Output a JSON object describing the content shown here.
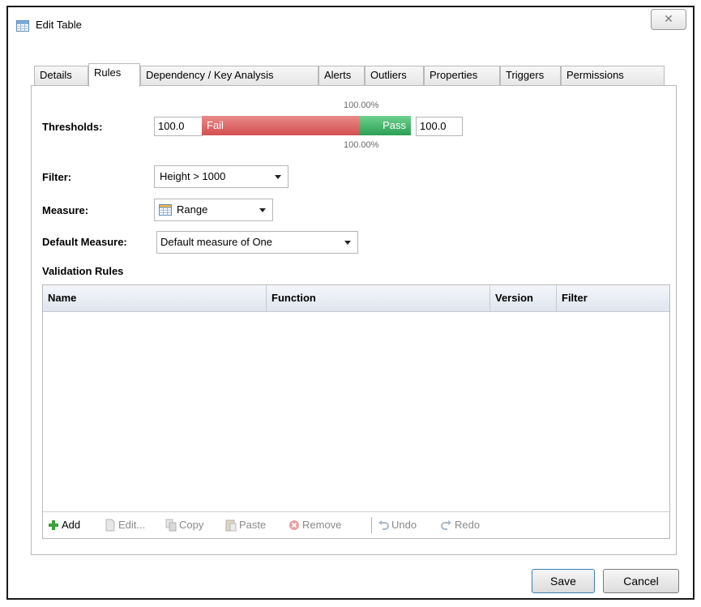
{
  "window": {
    "title": "Edit Table",
    "close_glyph": "✕"
  },
  "tabs": [
    {
      "label": "Details"
    },
    {
      "label": "Rules"
    },
    {
      "label": "Dependency / Key Analysis"
    },
    {
      "label": "Alerts"
    },
    {
      "label": "Outliers"
    },
    {
      "label": "Properties"
    },
    {
      "label": "Triggers"
    },
    {
      "label": "Permissions"
    }
  ],
  "active_tab": "Rules",
  "thresholds": {
    "label": "Thresholds:",
    "low_value": "100.0",
    "high_value": "100.0",
    "fail_label": "Fail",
    "pass_label": "Pass",
    "top_percent": "100.00%",
    "bottom_percent": "100.00%",
    "fail_fraction": 0.75,
    "fail_color": "#d9534f",
    "pass_color": "#3cb062"
  },
  "filter": {
    "label": "Filter:",
    "value": "Height > 1000"
  },
  "measure": {
    "label": "Measure:",
    "value": "Range",
    "icon": "table-icon"
  },
  "default_measure": {
    "label": "Default Measure:",
    "value": "Default measure of One"
  },
  "validation_rules": {
    "title": "Validation Rules",
    "columns": [
      "Name",
      "Function",
      "Version",
      "Filter"
    ],
    "rows": []
  },
  "toolbar": {
    "add": "Add",
    "edit": "Edit...",
    "copy": "Copy",
    "paste": "Paste",
    "remove": "Remove",
    "undo": "Undo",
    "redo": "Redo"
  },
  "buttons": {
    "save": "Save",
    "cancel": "Cancel"
  }
}
